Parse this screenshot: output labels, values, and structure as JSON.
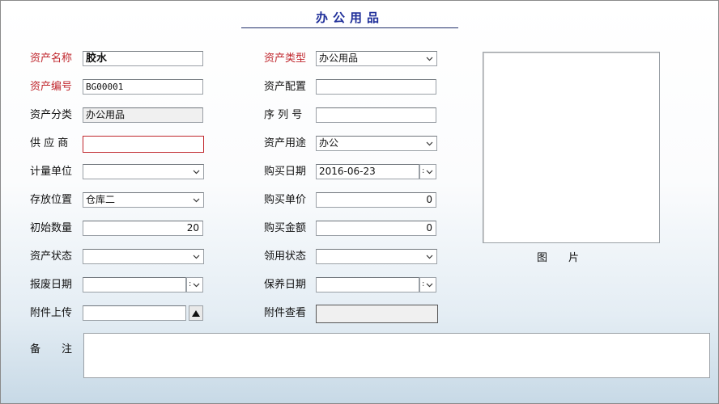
{
  "title": "办公用品",
  "colors": {
    "required_label": "#c0272d",
    "title": "#1f2f9a",
    "bg_bottom": "#c7d9e6"
  },
  "left": {
    "asset_name": {
      "label": "资产名称",
      "value": "胶水"
    },
    "asset_code": {
      "label": "资产编号",
      "value": "BG00001"
    },
    "asset_category": {
      "label": "资产分类",
      "value": "办公用品"
    },
    "supplier": {
      "label": "供 应 商",
      "value": ""
    },
    "unit": {
      "label": "计量单位",
      "value": ""
    },
    "location": {
      "label": "存放位置",
      "value": "仓库二"
    },
    "initial_qty": {
      "label": "初始数量",
      "value": "20"
    },
    "asset_status": {
      "label": "资产状态",
      "value": ""
    },
    "scrap_date": {
      "label": "报废日期",
      "value": ""
    },
    "attachment_upload": {
      "label": "附件上传",
      "value": ""
    }
  },
  "middle": {
    "asset_type": {
      "label": "资产类型",
      "value": "办公用品"
    },
    "asset_config": {
      "label": "资产配置",
      "value": ""
    },
    "serial_no": {
      "label": "序 列 号",
      "value": ""
    },
    "asset_use": {
      "label": "资产用途",
      "value": "办公"
    },
    "purchase_date": {
      "label": "购买日期",
      "value": "2016-06-23"
    },
    "unit_price": {
      "label": "购买单价",
      "value": "0"
    },
    "amount": {
      "label": "购买金额",
      "value": "0"
    },
    "claim_status": {
      "label": "领用状态",
      "value": ""
    },
    "maintenance_date": {
      "label": "保养日期",
      "value": ""
    },
    "attachment_view": {
      "label": "附件查看",
      "value": ""
    }
  },
  "picture_label": "图　　片",
  "remarks": {
    "label": "备　　注",
    "value": ""
  },
  "icons": {
    "dropdown": "chevron-down-icon",
    "upload": "triangle-up-icon"
  }
}
